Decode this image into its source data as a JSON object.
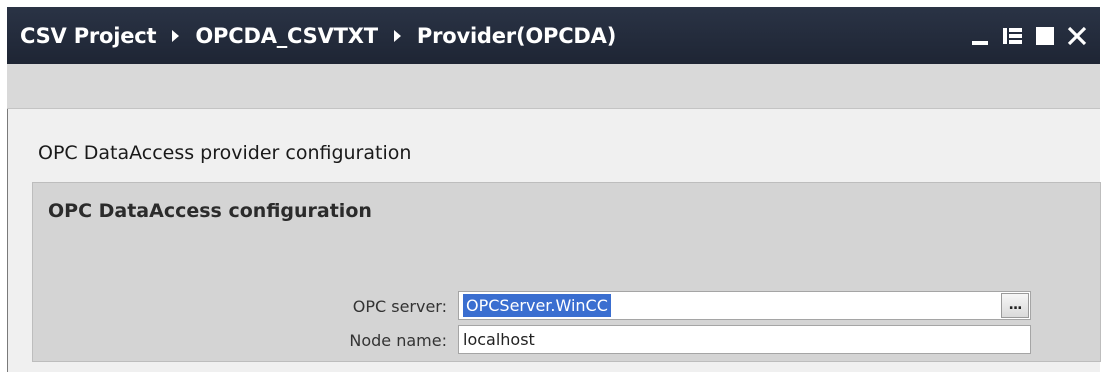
{
  "titlebar": {
    "breadcrumbs": [
      "CSV Project",
      "OPCDA_CSVTXT",
      "Provider(OPCDA)"
    ],
    "bg_color": "#1e2534",
    "controls": [
      "minimize-icon",
      "float-icon",
      "maximize-icon",
      "close-icon"
    ]
  },
  "main": {
    "section_title": "OPC DataAccess provider configuration",
    "group": {
      "title": "OPC DataAccess configuration",
      "opc_server": {
        "label": "OPC server:",
        "value": "OPCServer.WinCC",
        "browse_label": "..."
      },
      "node_name": {
        "label": "Node name:",
        "value": "localhost"
      }
    }
  },
  "colors": {
    "selection": "#3a6ed0",
    "group_bg": "#d4d4d4",
    "content_bg": "#f0f0f0",
    "toolbar_bg": "#d9d9d9"
  }
}
